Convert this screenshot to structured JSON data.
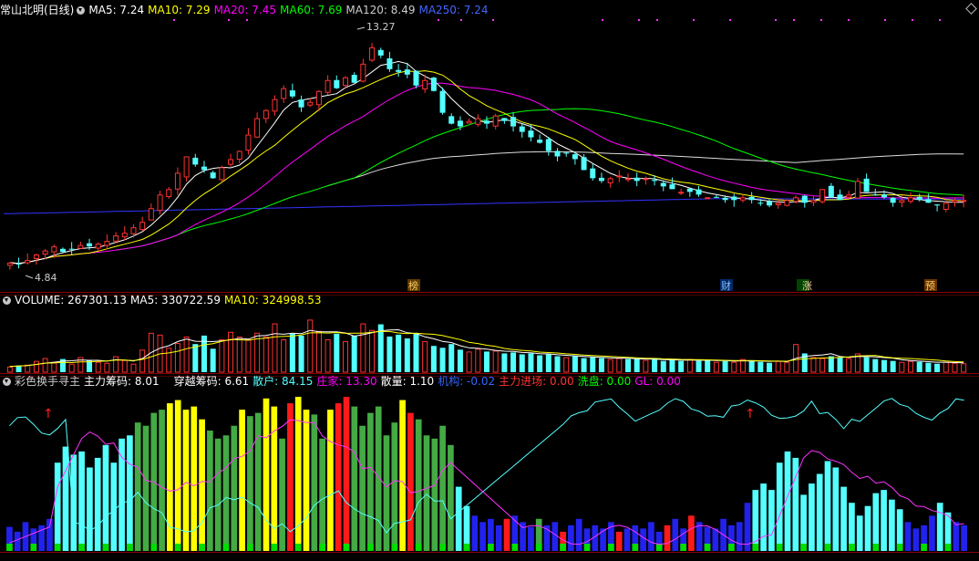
{
  "header": {
    "title": "常山北明(日线)",
    "ma5": "MA5: 7.24",
    "ma10": "MA10: 7.29",
    "ma20": "MA20: 7.45",
    "ma60": "MA60: 7.69",
    "ma120": "MA120: 8.49",
    "ma250": "MA250: 7.24"
  },
  "volume_header": {
    "label": "VOLUME: 267301.13",
    "ma5": "MA5: 330722.59",
    "ma10": "MA10: 324998.53"
  },
  "indicator_header": {
    "name": "彩色换手寻主",
    "zhuli": "主力筹码: 8.01",
    "chuanyue": "穿越筹码: 6.61",
    "sanhu": "散户: 84.15",
    "zhuangjia": "庄家: 13.30",
    "sanliang": "散量: 1.10",
    "jigou": "机构: -0.02",
    "jinchang": "主力进场: 0.00",
    "xipan": "洗盘: 0.00",
    "gl": "GL: 0.00"
  },
  "annotations": {
    "high": "13.27",
    "low": "4.84",
    "markers": [
      "榜",
      "财",
      "涨",
      "预"
    ]
  },
  "colors": {
    "up": "#ff3232",
    "down": "#54ffff",
    "ma5": "#ffffff",
    "ma10": "#ffff00",
    "ma20": "#ff00ff",
    "ma60": "#00ff00",
    "ma120": "#ffffff",
    "ma250": "#3333ff",
    "grid": "#8b0000"
  },
  "chart_data": [
    {
      "type": "candlestick",
      "title": "常山北明(日线)",
      "ylim": [
        4.5,
        13.8
      ],
      "high": 13.27,
      "low": 4.84,
      "closes": [
        4.9,
        4.85,
        5.0,
        5.2,
        5.35,
        5.5,
        5.3,
        5.4,
        5.55,
        5.5,
        5.6,
        5.7,
        5.9,
        6.0,
        6.2,
        6.4,
        6.9,
        7.4,
        7.6,
        8.2,
        8.8,
        8.5,
        8.3,
        8.0,
        8.4,
        8.7,
        9.0,
        9.6,
        10.2,
        10.5,
        10.9,
        11.3,
        11.0,
        10.6,
        10.8,
        11.2,
        11.6,
        11.3,
        11.7,
        11.5,
        12.2,
        12.8,
        12.5,
        12.0,
        11.9,
        11.8,
        11.4,
        11.6,
        11.2,
        10.4,
        10.0,
        9.9,
        10.1,
        10.2,
        10.0,
        10.3,
        10.1,
        9.9,
        9.7,
        9.5,
        9.3,
        9.0,
        8.8,
        8.9,
        8.7,
        8.3,
        8.0,
        7.9,
        8.0,
        8.1,
        8.0,
        7.9,
        8.0,
        7.9,
        7.7,
        7.6,
        7.5,
        7.5,
        7.4,
        7.3,
        7.3,
        7.2,
        7.2,
        7.3,
        7.2,
        7.1,
        7.0,
        7.1,
        7.2,
        7.3,
        7.1,
        7.2,
        7.6,
        7.3,
        7.2,
        7.4,
        7.9,
        7.5,
        7.4,
        7.3,
        7.1,
        7.2,
        7.3,
        7.2,
        7.1,
        7.0,
        7.1,
        7.2,
        7.2
      ],
      "series": [
        {
          "name": "MA5",
          "value": 7.24
        },
        {
          "name": "MA10",
          "value": 7.29
        },
        {
          "name": "MA20",
          "value": 7.45
        },
        {
          "name": "MA60",
          "value": 7.69
        },
        {
          "name": "MA120",
          "value": 8.49
        },
        {
          "name": "MA250",
          "value": 7.24
        }
      ]
    },
    {
      "type": "bar",
      "title": "VOLUME",
      "ylim": [
        0,
        700000
      ],
      "values": [
        60000,
        70000,
        80000,
        120000,
        150000,
        110000,
        140000,
        90000,
        160000,
        130000,
        110000,
        100000,
        170000,
        130000,
        90000,
        240000,
        420000,
        400000,
        260000,
        310000,
        380000,
        300000,
        390000,
        250000,
        350000,
        430000,
        380000,
        350000,
        420000,
        380000,
        520000,
        350000,
        410000,
        390000,
        560000,
        440000,
        350000,
        410000,
        330000,
        390000,
        520000,
        450000,
        510000,
        380000,
        400000,
        360000,
        410000,
        330000,
        280000,
        260000,
        300000,
        240000,
        220000,
        250000,
        220000,
        230000,
        200000,
        210000,
        190000,
        200000,
        180000,
        190000,
        170000,
        160000,
        170000,
        150000,
        160000,
        150000,
        140000,
        150000,
        140000,
        140000,
        130000,
        140000,
        120000,
        130000,
        120000,
        140000,
        120000,
        130000,
        110000,
        120000,
        110000,
        140000,
        120000,
        110000,
        100000,
        120000,
        110000,
        300000,
        200000,
        160000,
        150000,
        170000,
        160000,
        150000,
        200000,
        160000,
        140000,
        130000,
        120000,
        110000,
        120000,
        110000,
        100000,
        90000,
        110000,
        100000,
        95000
      ],
      "series": [
        {
          "name": "VOLUME",
          "value": 267301.13
        },
        {
          "name": "MA5",
          "value": 330722.59
        },
        {
          "name": "MA10",
          "value": 324998.53
        }
      ]
    },
    {
      "type": "bar",
      "title": "彩色换手寻主",
      "ylim": [
        0,
        100
      ],
      "values": [
        15,
        12,
        18,
        14,
        16,
        20,
        55,
        65,
        60,
        62,
        52,
        58,
        66,
        55,
        70,
        72,
        80,
        78,
        86,
        88,
        92,
        94,
        88,
        90,
        82,
        75,
        70,
        72,
        78,
        88,
        84,
        86,
        95,
        90,
        70,
        92,
        96,
        88,
        85,
        70,
        88,
        92,
        96,
        90,
        78,
        86,
        90,
        72,
        80,
        94,
        86,
        82,
        72,
        70,
        78,
        66,
        40,
        28,
        22,
        18,
        20,
        16,
        20,
        22,
        18,
        15,
        20,
        16,
        18,
        12,
        16,
        20,
        14,
        16,
        14,
        18,
        12,
        14,
        16,
        14,
        18,
        12,
        16,
        20,
        14,
        22,
        18,
        15,
        14,
        20,
        16,
        18,
        30,
        38,
        42,
        38,
        55,
        62,
        58,
        35,
        42,
        48,
        56,
        52,
        40,
        30,
        22,
        28,
        36,
        38,
        32,
        26,
        18,
        14,
        16,
        22,
        30,
        24,
        18,
        16
      ],
      "colors": [
        "b",
        "b",
        "b",
        "b",
        "b",
        "b",
        "c",
        "c",
        "c",
        "c",
        "c",
        "c",
        "c",
        "c",
        "c",
        "c",
        "g",
        "g",
        "g",
        "g",
        "y",
        "y",
        "y",
        "y",
        "y",
        "g",
        "g",
        "g",
        "g",
        "y",
        "g",
        "g",
        "y",
        "y",
        "g",
        "r",
        "y",
        "y",
        "g",
        "g",
        "y",
        "r",
        "r",
        "g",
        "g",
        "g",
        "g",
        "g",
        "g",
        "y",
        "r",
        "g",
        "g",
        "g",
        "g",
        "g",
        "c",
        "c",
        "b",
        "b",
        "b",
        "b",
        "r",
        "b",
        "b",
        "b",
        "g",
        "b",
        "b",
        "r",
        "b",
        "b",
        "b",
        "b",
        "b",
        "b",
        "r",
        "b",
        "b",
        "b",
        "b",
        "b",
        "r",
        "b",
        "b",
        "r",
        "b",
        "b",
        "b",
        "b",
        "b",
        "b",
        "b",
        "c",
        "c",
        "c",
        "c",
        "c",
        "c",
        "c",
        "c",
        "c",
        "c",
        "c",
        "c",
        "c",
        "c",
        "c",
        "c",
        "c",
        "c",
        "c",
        "b",
        "b",
        "b",
        "b",
        "c",
        "c",
        "b",
        "b"
      ],
      "series": [
        {
          "name": "主力筹码",
          "value": 8.01
        },
        {
          "name": "穿越筹码",
          "value": 6.61
        },
        {
          "name": "散户",
          "value": 84.15
        },
        {
          "name": "庄家",
          "value": 13.3
        },
        {
          "name": "散量",
          "value": 1.1
        },
        {
          "name": "机构",
          "value": -0.02
        },
        {
          "name": "主力进场",
          "value": 0.0
        },
        {
          "name": "洗盘",
          "value": 0.0
        },
        {
          "name": "GL",
          "value": 0.0
        }
      ]
    }
  ]
}
